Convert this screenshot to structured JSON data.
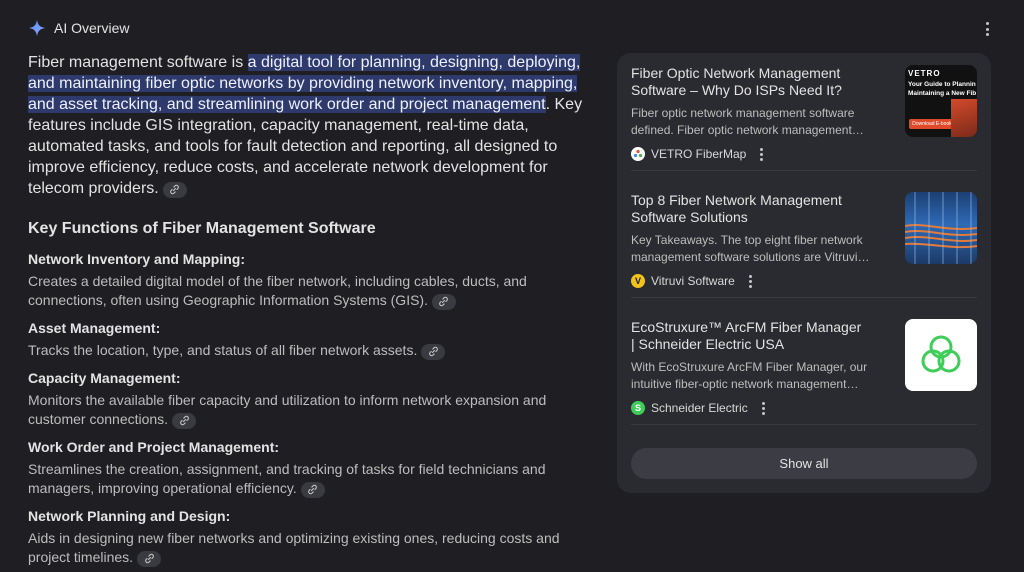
{
  "header": {
    "title": "AI Overview"
  },
  "intro": {
    "before": "Fiber management software is ",
    "highlight": "a digital tool for planning, designing, deploying, and maintaining fiber optic networks by providing network inventory, mapping, and asset tracking, and streamlining work order and project management",
    "after": ". Key features include GIS integration, capacity management, real-time data, automated tasks, and tools for fault detection and reporting, all designed to improve efficiency, reduce costs, and accelerate network development for telecom providers."
  },
  "section": {
    "title": "Key Functions of Fiber Management Software"
  },
  "functions": [
    {
      "title": "Network Inventory and Mapping:",
      "desc": "Creates a detailed digital model of the fiber network, including cables, ducts, and connections, often using Geographic Information Systems (GIS)."
    },
    {
      "title": "Asset Management:",
      "desc": "Tracks the location, type, and status of all fiber network assets."
    },
    {
      "title": "Capacity Management:",
      "desc": "Monitors the available fiber capacity and utilization to inform network expansion and customer connections."
    },
    {
      "title": "Work Order and Project Management:",
      "desc": "Streamlines the creation, assignment, and tracking of tasks for field technicians and managers, improving operational efficiency."
    },
    {
      "title": "Network Planning and Design:",
      "desc": "Aids in designing new fiber networks and optimizing existing ones, reducing costs and project timelines."
    }
  ],
  "sources": [
    {
      "title": "Fiber Optic Network Management Software – Why Do ISPs Need It?",
      "snippet": "Fiber optic network management software defined. Fiber optic network management…",
      "site": "VETRO FiberMap",
      "thumb_text": {
        "brand": "VETRO",
        "line1": "Your Guide to Planning,",
        "line2": "Maintaining a New Fiber",
        "button": "Download E-book"
      }
    },
    {
      "title": "Top 8 Fiber Network Management Software Solutions",
      "snippet": "Key Takeaways. The top eight fiber network management software solutions are Vitruvi…",
      "site": "Vitruvi Software"
    },
    {
      "title": "EcoStruxure™ ArcFM Fiber Manager | Schneider Electric USA",
      "snippet": "With EcoStruxure ArcFM Fiber Manager, our intuitive fiber-optic network management…",
      "site": "Schneider Electric"
    }
  ],
  "show_all_label": "Show all",
  "colors": {
    "background": "#1f1f23",
    "panel": "#2a2b30",
    "highlight": "#2d3a6b",
    "schneider_green": "#3dcd58"
  }
}
